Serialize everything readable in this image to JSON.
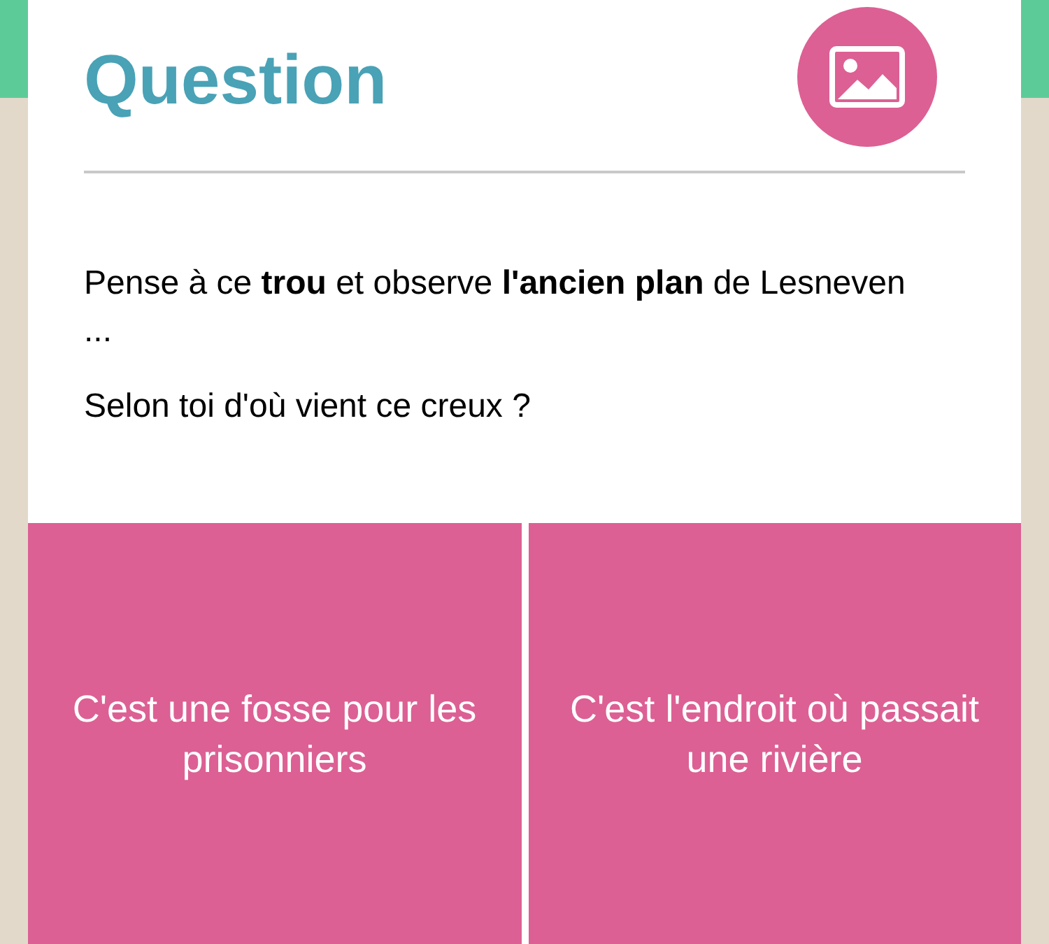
{
  "title": "Question",
  "paragraphs": [
    "Pense à ce **trou** et observe **l'ancien plan** de Lesneven ...",
    "Selon toi d'où vient ce creux ?"
  ],
  "answers": [
    "C'est une fosse pour les prisonniers",
    "C'est l'endroit où passait une rivière"
  ]
}
